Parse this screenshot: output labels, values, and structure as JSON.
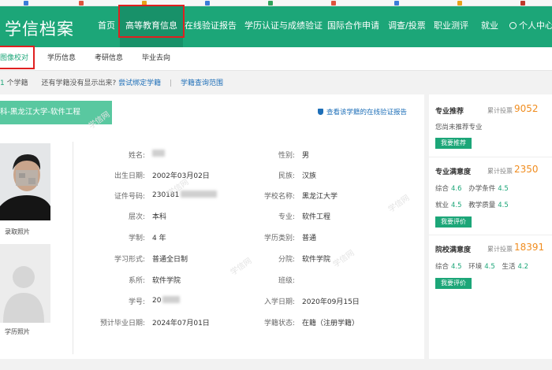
{
  "header": {
    "logo": "学信档案",
    "nav": [
      {
        "label": "首页"
      },
      {
        "label": "高等教育信息"
      },
      {
        "label": "在线验证报告"
      },
      {
        "label": "学历认证与成绩验证"
      },
      {
        "label": "国际合作申请"
      },
      {
        "label": "调查/投票"
      },
      {
        "label": "职业测评"
      },
      {
        "label": "就业"
      },
      {
        "label": "个人中心"
      }
    ]
  },
  "subnav": [
    {
      "label": "图像校对"
    },
    {
      "label": "学历信息"
    },
    {
      "label": "考研信息"
    },
    {
      "label": "毕业去向"
    }
  ],
  "info": {
    "count": "1",
    "count_label": "个学籍",
    "question": "还有学籍没有显示出来?",
    "bind_link": "尝试绑定学籍",
    "sep": "|",
    "scope_link": "学籍查询范围"
  },
  "record": {
    "banner": "科-黑龙江大学-软件工程",
    "verify_link": "查看该学籍的在线验证报告",
    "photo1_caption": "录取照片",
    "photo2_caption": "学历照片",
    "left_fields": [
      {
        "label": "姓名:",
        "value": "",
        "blurred": true
      },
      {
        "label": "出生日期:",
        "value": "2002年03月02日"
      },
      {
        "label": "证件号码:",
        "value": "230181",
        "blurred": true
      },
      {
        "label": "层次:",
        "value": "本科"
      },
      {
        "label": "学制:",
        "value": "4 年"
      },
      {
        "label": "学习形式:",
        "value": "普通全日制"
      },
      {
        "label": "系所:",
        "value": "软件学院"
      },
      {
        "label": "学号:",
        "value": "20",
        "blurred": true
      },
      {
        "label": "预计毕业日期:",
        "value": "2024年07月01日"
      }
    ],
    "right_fields": [
      {
        "label": "性别:",
        "value": "男"
      },
      {
        "label": "民族:",
        "value": "汉族"
      },
      {
        "label": "学校名称:",
        "value": "黑龙江大学"
      },
      {
        "label": "专业:",
        "value": "软件工程"
      },
      {
        "label": "学历类别:",
        "value": "普通"
      },
      {
        "label": "分院:",
        "value": "软件学院"
      },
      {
        "label": "班级:",
        "value": ""
      },
      {
        "label": "入学日期:",
        "value": "2020年09月15日"
      },
      {
        "label": "学籍状态:",
        "value": "在籍（注册学籍）"
      }
    ],
    "watermark": "学信网"
  },
  "sidebar": {
    "recommend": {
      "title": "专业推荐",
      "count_label": "累计投票",
      "count": "9052",
      "text": "您尚未推荐专业",
      "button": "我要推荐"
    },
    "major": {
      "title": "专业满意度",
      "count_label": "累计投票",
      "count": "2350",
      "rows": [
        [
          {
            "k": "综合",
            "v": "4.6"
          },
          {
            "k": "办学条件",
            "v": "4.5"
          }
        ],
        [
          {
            "k": "就业",
            "v": "4.5"
          },
          {
            "k": "教学质量",
            "v": "4.5"
          }
        ]
      ],
      "button": "我要评价"
    },
    "school": {
      "title": "院校满意度",
      "count_label": "累计投票",
      "count": "18391",
      "rows": [
        [
          {
            "k": "综合",
            "v": "4.5"
          },
          {
            "k": "环境",
            "v": "4.5"
          },
          {
            "k": "生活",
            "v": "4.2"
          }
        ]
      ],
      "button": "我要评价"
    }
  },
  "colors": {
    "brand": "#1ca678",
    "highlight": "#e02020",
    "link": "#1e6fb8",
    "score": "#f08c1e"
  }
}
